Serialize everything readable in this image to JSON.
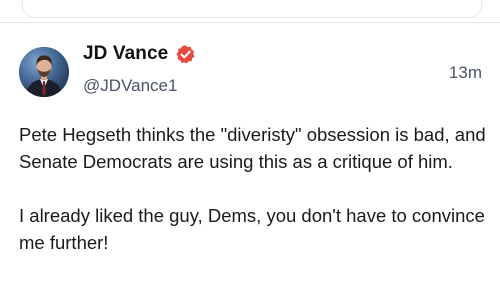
{
  "post": {
    "author_name": "JD Vance",
    "handle": "@JDVance1",
    "timestamp": "13m",
    "paragraphs": [
      "Pete Hegseth thinks the \"diveristy\" obsession is bad, and Senate Democrats are using this as a critique of him.",
      "I already liked the guy, Dems, you don't have to convince me further!"
    ],
    "verified_badge_color": "#e84a3f",
    "avatar_icon": "profile-photo"
  }
}
